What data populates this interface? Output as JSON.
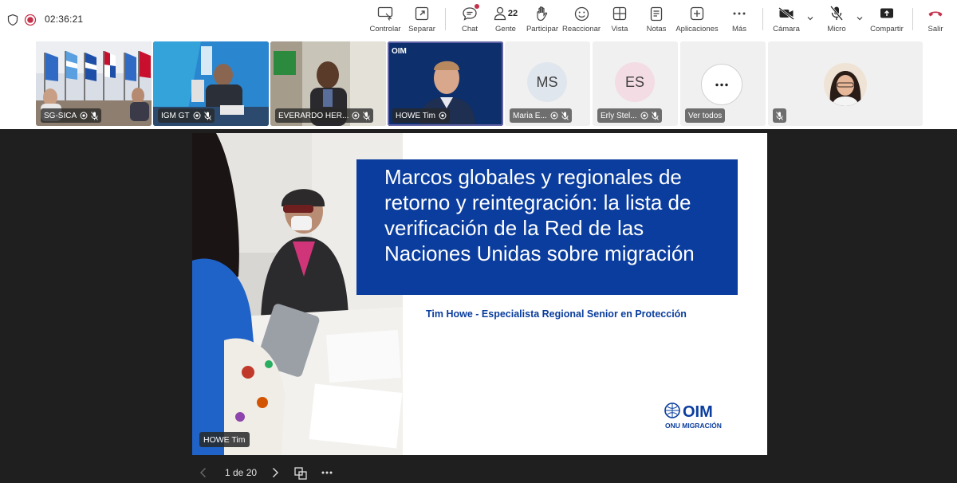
{
  "toolbar": {
    "timer": "02:36:21",
    "buttons": {
      "controlar": "Controlar",
      "separar": "Separar",
      "chat": "Chat",
      "gente": "Gente",
      "gente_count": "22",
      "participar": "Participar",
      "reaccionar": "Reaccionar",
      "vista": "Vista",
      "notas": "Notas",
      "aplicaciones": "Aplicaciones",
      "mas": "Más",
      "camara": "Cámara",
      "micro": "Micro",
      "compartir": "Compartir",
      "salir": "Salir"
    },
    "colors": {
      "leave": "#c4314b",
      "text": "#424242"
    }
  },
  "participants": [
    {
      "name": "SG-SICA"
    },
    {
      "name": "IGM GT"
    },
    {
      "name": "EVERARDO HER..."
    },
    {
      "name": "HOWE Tim"
    },
    {
      "name": "Maria E...",
      "initials": "MS"
    },
    {
      "name": "Erly Stel...",
      "initials": "ES"
    },
    {
      "name": "Ver todos"
    },
    {
      "name": ""
    }
  ],
  "slide": {
    "title": "Marcos globales y regionales de retorno y reintegración: la lista de verificación de la Red de las Naciones Unidas sobre migración",
    "subtitle": "Tim Howe - Especialista Regional Senior en Protección",
    "logo_text": "OIM",
    "logo_subtext": "ONU MIGRACIÓN",
    "title_bg": "#0a3d9e"
  },
  "presenter": "HOWE Tim",
  "nav": {
    "page": "1 de 20"
  }
}
